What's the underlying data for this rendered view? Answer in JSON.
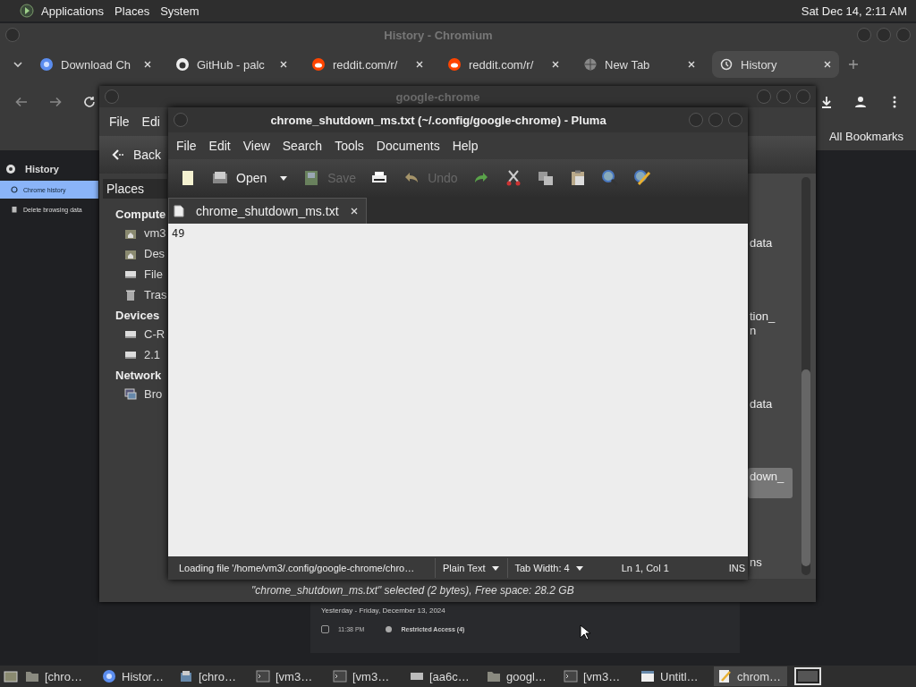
{
  "top_panel": {
    "menus": [
      "Applications",
      "Places",
      "System"
    ],
    "clock": "Sat Dec 14,  2:11 AM"
  },
  "browser": {
    "title": "History - Chromium",
    "tabs": [
      {
        "label": "Download Ch",
        "kind": "chrome",
        "selected": false
      },
      {
        "label": "GitHub - palc",
        "kind": "github",
        "selected": false
      },
      {
        "label": "reddit.com/r/",
        "kind": "reddit",
        "selected": false
      },
      {
        "label": "reddit.com/r/",
        "kind": "reddit",
        "selected": false
      },
      {
        "label": "New Tab",
        "kind": "globe",
        "selected": false
      },
      {
        "label": "History",
        "kind": "history",
        "selected": true
      }
    ],
    "bookmarks_bar": "All Bookmarks",
    "sidebar": {
      "heading": "History",
      "items": [
        {
          "label": "Chrome history",
          "kind": "history",
          "selected": true
        },
        {
          "label": "Delete browsing data",
          "kind": "trash",
          "selected": false
        }
      ]
    },
    "history": {
      "day": "Yesterday - Friday, December 13, 2024",
      "entries": [
        {
          "time": "11:38 PM",
          "title": "Restricted Access (4)",
          "checked": false
        }
      ]
    }
  },
  "file_manager": {
    "title": "google-chrome",
    "menus": [
      "File",
      "Edi"
    ],
    "back": "Back",
    "places": "Places",
    "sections": [
      {
        "heading": "Compute",
        "items": [
          {
            "label": "vm3",
            "kind": "home"
          },
          {
            "label": "Des",
            "kind": "home"
          },
          {
            "label": "File",
            "kind": "drive"
          },
          {
            "label": "Tras",
            "kind": "trash"
          }
        ]
      },
      {
        "heading": "Devices",
        "items": [
          {
            "label": "C-R",
            "kind": "drive"
          },
          {
            "label": "2.1",
            "kind": "drive"
          }
        ]
      },
      {
        "heading": "Network",
        "items": [
          {
            "label": "Bro",
            "kind": "network"
          }
        ]
      }
    ],
    "files": [
      {
        "lines": [
          "data"
        ],
        "selected": false
      },
      {
        "lines": [
          "tion_",
          "n"
        ],
        "selected": false
      },
      {
        "lines": [
          "data"
        ],
        "selected": false
      },
      {
        "lines": [
          "down_"
        ],
        "selected": true
      },
      {
        "lines": [
          "ns"
        ],
        "selected": false
      }
    ],
    "status": "\"chrome_shutdown_ms.txt\" selected (2 bytes), Free space: 28.2 GB"
  },
  "editor": {
    "title": "chrome_shutdown_ms.txt (~/.config/google-chrome) - Pluma",
    "menus": [
      "File",
      "Edit",
      "View",
      "Search",
      "Tools",
      "Documents",
      "Help"
    ],
    "toolbar": [
      {
        "kind": "new",
        "disabled": false
      },
      {
        "kind": "open",
        "label": "Open",
        "disabled": false
      },
      {
        "kind": "save",
        "label": "Save",
        "disabled": true
      },
      {
        "kind": "print",
        "disabled": false
      },
      {
        "kind": "undo",
        "label": "Undo",
        "disabled": true
      },
      {
        "kind": "redo",
        "disabled": false
      },
      {
        "kind": "cut",
        "disabled": false
      },
      {
        "kind": "copy",
        "disabled": false
      },
      {
        "kind": "paste",
        "disabled": false
      },
      {
        "kind": "find",
        "disabled": false
      },
      {
        "kind": "replace",
        "disabled": false
      }
    ],
    "document_tab": "chrome_shutdown_ms.txt",
    "content": "49",
    "status": {
      "message": "Loading file '/home/vm3/.config/google-chrome/chro…",
      "language": "Plain Text",
      "tab_width": "Tab Width:  4",
      "position": "Ln 1, Col 1",
      "mode": "INS"
    }
  },
  "taskbar": [
    {
      "label": "[chro…",
      "kind": "folder",
      "selected": false
    },
    {
      "label": "Histor…",
      "kind": "chrome",
      "selected": false
    },
    {
      "label": "[chro…",
      "kind": "files",
      "selected": false
    },
    {
      "label": "[vm3…",
      "kind": "terminal",
      "selected": false
    },
    {
      "label": "[vm3…",
      "kind": "terminal",
      "selected": false
    },
    {
      "label": "[aa6c…",
      "kind": "drive",
      "selected": false
    },
    {
      "label": "googl…",
      "kind": "folder",
      "selected": false
    },
    {
      "label": "[vm3…",
      "kind": "terminal",
      "selected": false
    },
    {
      "label": "Untitl…",
      "kind": "window",
      "selected": false
    },
    {
      "label": "chrom…",
      "kind": "editor",
      "selected": true
    }
  ]
}
